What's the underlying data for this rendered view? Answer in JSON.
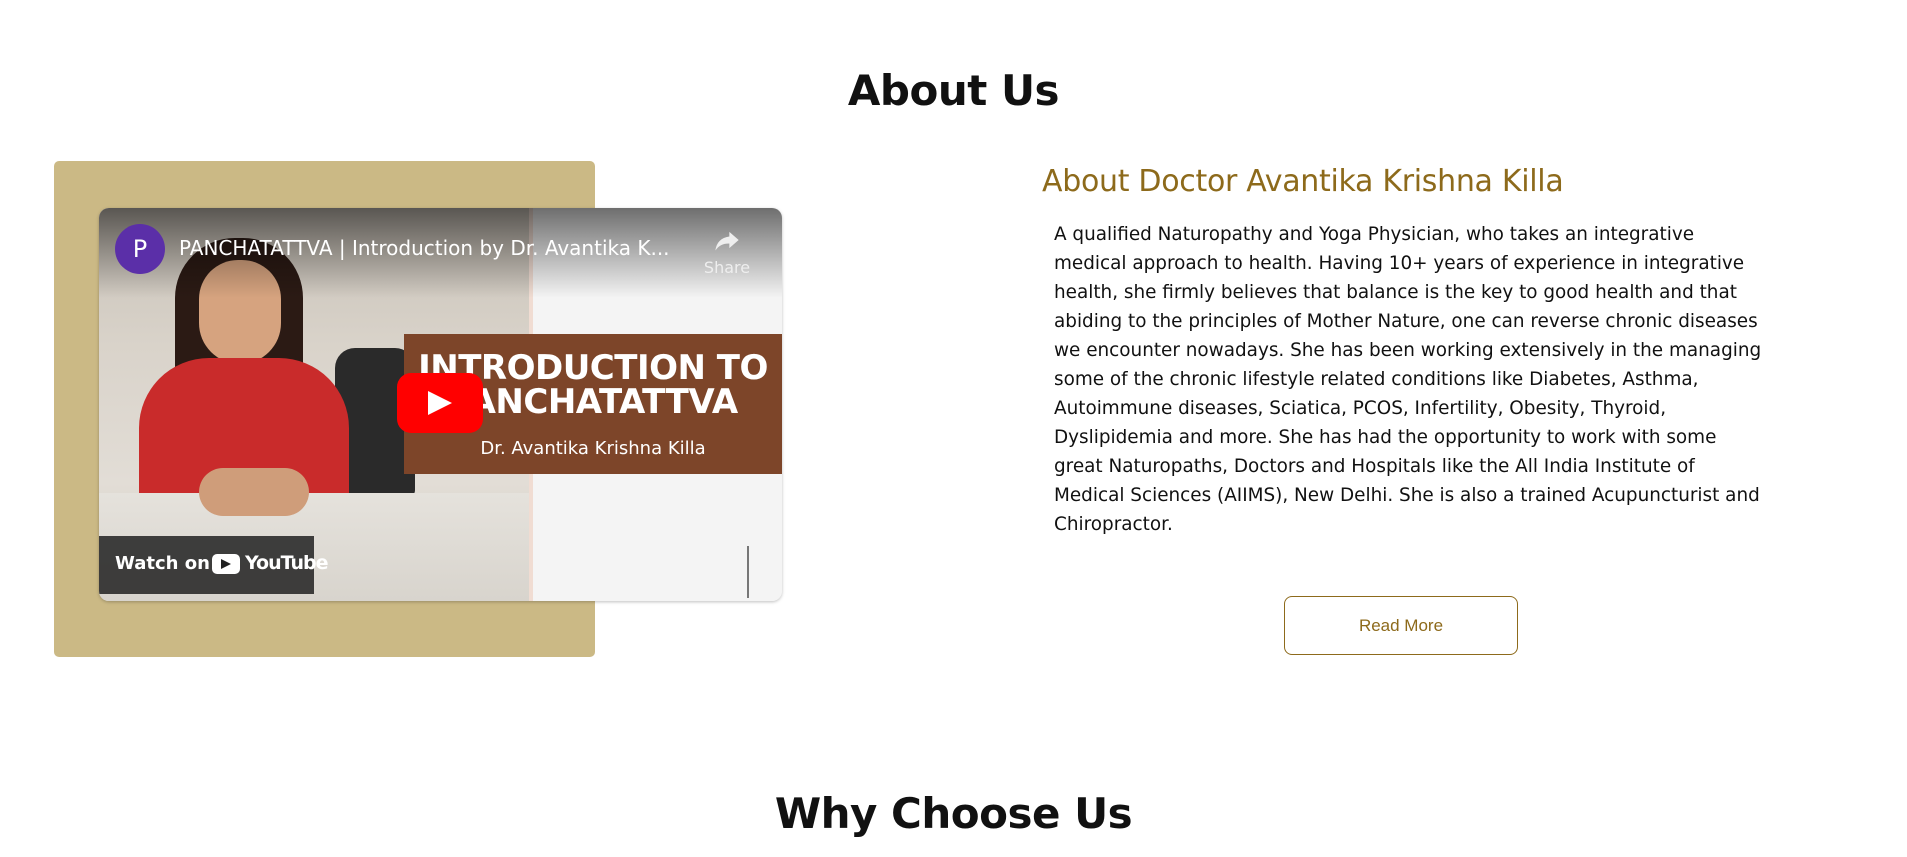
{
  "about_section": {
    "title": "About Us",
    "video": {
      "channel_initial": "P",
      "title": "PANCHATATTVA | Introduction by Dr. Avantika K...",
      "share_label": "Share",
      "card_line1": "INTRODUCTION TO",
      "card_line2": "PANCHATATTVA",
      "card_line3": "Dr. Avantika Krishna Killa",
      "watch_on_label": "Watch on",
      "youtube_wordmark": "YouTube"
    },
    "doctor": {
      "heading": "About Doctor Avantika Krishna Killa",
      "bio": "A qualified Naturopathy and Yoga Physician, who takes an integrative medical approach to health. Having 10+ years of experience in integrative health, she firmly believes that balance is the key to good health and that abiding to the principles of Mother Nature, one can reverse chronic diseases we encounter nowadays. She has been working extensively in the managing some of the chronic lifestyle related conditions like Diabetes, Asthma, Autoimmune diseases, Sciatica, PCOS, Infertility, Obesity, Thyroid, Dyslipidemia and more. She has had the opportunity to work with some great Naturopaths, Doctors and Hospitals like the All India Institute of Medical Sciences (AIIMS), New Delhi. She is also a trained Acupuncturist and Chiropractor.",
      "read_more_label": "Read More"
    }
  },
  "why_section": {
    "title": "Why Choose Us"
  },
  "colors": {
    "accent_gold": "#8d6a1b",
    "block_tan": "#cbb985",
    "youtube_red": "#ff0000",
    "card_brown": "#7d4529"
  },
  "icons": [
    "share-icon",
    "play-icon",
    "youtube-logo-icon"
  ]
}
